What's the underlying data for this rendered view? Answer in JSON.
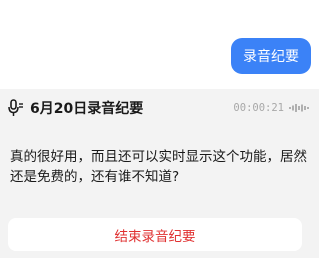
{
  "message": {
    "text": "录音纪要"
  },
  "recording": {
    "title": "6月20日录音纪要",
    "timer": "00:00:21",
    "transcript": "真的很好用，而且还可以实时显示这个功能，居然还是免费的，还有谁不知道?",
    "end_button_label": "结束录音纪要",
    "icons": {
      "title_icon": "microphone-icon",
      "status_icon": "audio-wave-icon"
    }
  },
  "colors": {
    "bubble_bg": "#3b82f7",
    "card_bg": "#f3f3f3",
    "end_button_text": "#e03131",
    "timer_text": "#a8a8a8"
  }
}
